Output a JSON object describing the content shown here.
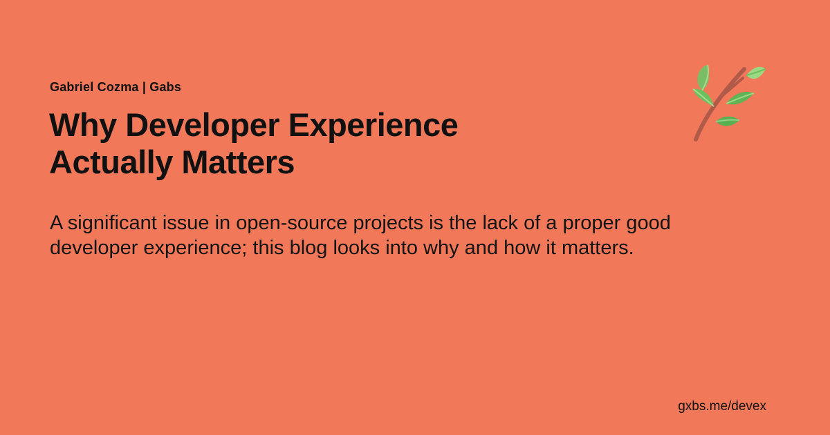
{
  "card": {
    "author": "Gabriel Cozma | Gabs",
    "title_lines": [
      "Why Developer Experience",
      "Actually Matters"
    ],
    "description": "A significant issue in open-source projects is the lack of a proper good developer experience; this blog looks into why and how it matters.",
    "url": "gxbs.me/devex",
    "logo_icon": "leafy-branch-icon"
  },
  "colors": {
    "background": "#F17858",
    "text": "#111111",
    "branch": "#B05A4A",
    "leaf_light": "#8FD08A",
    "leaf_dark": "#5AAF50"
  }
}
